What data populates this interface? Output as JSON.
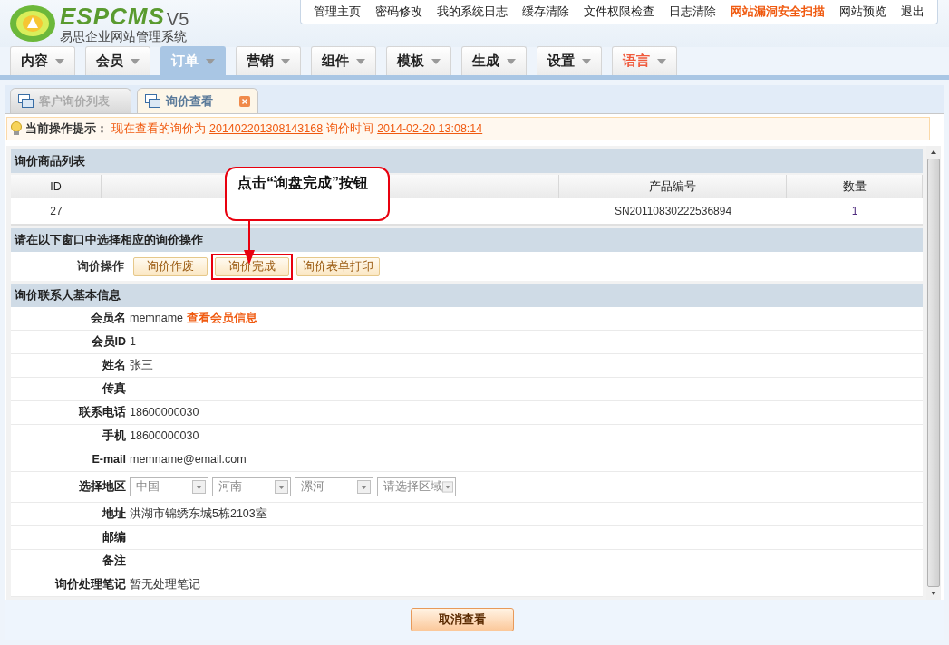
{
  "logo": {
    "name": "ESPCMS",
    "version": "V5",
    "subtitle": "易思企业网站管理系统"
  },
  "top_links": [
    {
      "label": "管理主页",
      "highlight": false
    },
    {
      "label": "密码修改",
      "highlight": false
    },
    {
      "label": "我的系统日志",
      "highlight": false
    },
    {
      "label": "缓存清除",
      "highlight": false
    },
    {
      "label": "文件权限检查",
      "highlight": false
    },
    {
      "label": "日志清除",
      "highlight": false
    },
    {
      "label": "网站漏洞安全扫描",
      "highlight": true
    },
    {
      "label": "网站预览",
      "highlight": false
    },
    {
      "label": "退出",
      "highlight": false
    }
  ],
  "nav": [
    {
      "label": "内容",
      "selected": false,
      "highlight": false
    },
    {
      "label": "会员",
      "selected": false,
      "highlight": false
    },
    {
      "label": "订单",
      "selected": true,
      "highlight": false
    },
    {
      "label": "营销",
      "selected": false,
      "highlight": false
    },
    {
      "label": "组件",
      "selected": false,
      "highlight": false
    },
    {
      "label": "模板",
      "selected": false,
      "highlight": false
    },
    {
      "label": "生成",
      "selected": false,
      "highlight": false
    },
    {
      "label": "设置",
      "selected": false,
      "highlight": false
    },
    {
      "label": "语言",
      "selected": false,
      "highlight": true
    }
  ],
  "tabs": [
    {
      "label": "客户询价列表",
      "selected": false,
      "closable": false
    },
    {
      "label": "询价查看",
      "selected": true,
      "closable": true
    }
  ],
  "notice": {
    "label": "当前操作提示：",
    "text": "现在查看的询价为",
    "number": "201402201308143168",
    "time_label": "询价时间",
    "time": "2014-02-20 13:08:14"
  },
  "products": {
    "title": "询价商品列表",
    "columns": [
      "ID",
      "",
      "产品编号",
      "数量"
    ],
    "rows": [
      [
        "27",
        "",
        "SN20110830222536894",
        "1"
      ]
    ]
  },
  "actions": {
    "title": "请在以下窗口中选择相应的询价操作",
    "label": "询价操作",
    "buttons": [
      {
        "label": "询价作废",
        "highlighted": false
      },
      {
        "label": "询价完成",
        "highlighted": true
      },
      {
        "label": "询价表单打印",
        "highlighted": false
      }
    ]
  },
  "contact": {
    "title": "询价联系人基本信息",
    "rows": [
      {
        "kind": "text",
        "label": "会员名",
        "value": "memname",
        "link": "查看会员信息"
      },
      {
        "kind": "text",
        "label": "会员ID",
        "value": "1"
      },
      {
        "kind": "text",
        "label": "姓名",
        "value": "张三"
      },
      {
        "kind": "text",
        "label": "传真"
      },
      {
        "kind": "text",
        "label": "联系电话",
        "value": "18600000030"
      },
      {
        "kind": "text",
        "label": "手机",
        "value": "18600000030"
      },
      {
        "kind": "text",
        "label": "E-mail",
        "value": "memname@email.com"
      },
      {
        "kind": "region",
        "label": "选择地区",
        "selects": [
          "中国",
          "河南",
          "漯河",
          "请选择区域"
        ]
      },
      {
        "kind": "text",
        "label": "地址",
        "value": "洪湖市锦绣东城5栋2103室"
      },
      {
        "kind": "text",
        "label": "邮编"
      },
      {
        "kind": "text",
        "label": "备注"
      },
      {
        "kind": "text",
        "label": "询价处理笔记",
        "value": "暂无处理笔记"
      }
    ]
  },
  "callout": {
    "text": "点击“询盘完成”按钮"
  },
  "footer_button": "取消查看"
}
